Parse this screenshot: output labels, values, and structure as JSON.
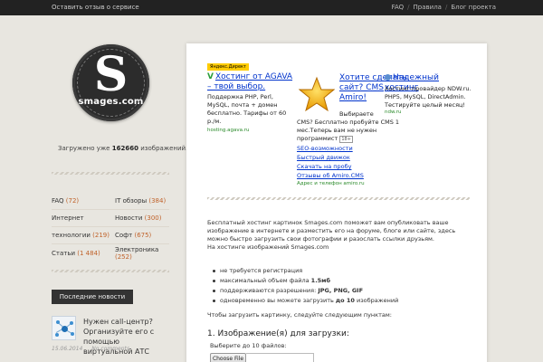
{
  "topbar": {
    "feedback": "Оставить отзыв о сервисе",
    "links": [
      "FAQ",
      "Правила",
      "Блог проекта"
    ]
  },
  "logo": {
    "letter": "S",
    "domain": "smages.com"
  },
  "stats": {
    "prefix": "Загружено уже",
    "count": "162660",
    "suffix": "изображений."
  },
  "categories": [
    [
      {
        "name": "FAQ",
        "count": "(72)"
      },
      {
        "name": "IT обзоры",
        "count": "(384)"
      }
    ],
    [
      {
        "name": "Интернет",
        "count": ""
      },
      {
        "name": "Новости",
        "count": "(300)"
      }
    ],
    [
      {
        "name": "технологии",
        "count": "(219)"
      },
      {
        "name": "Софт",
        "count": "(675)"
      }
    ],
    [
      {
        "name": "Статьи",
        "count": "(1 484)"
      },
      {
        "name": "Электроника",
        "count": "(252)"
      }
    ]
  ],
  "news": {
    "button": "Последние новости",
    "title": "Нужен call-центр? Организуйте его с помощью виртуальной АТС",
    "date": "15.06.2014",
    "comments": "No comments"
  },
  "ads": {
    "label": "Яндекс.Директ",
    "ad1": {
      "chevron": "V",
      "title": "Хостинг от AGAVA – твой выбор.",
      "text": "Поддержка PHP, Perl, MySQL, почта + домен бесплатно. Тарифы от 60 р./м.",
      "host": "hosting.agava.ru"
    },
    "ad2": {
      "title": "Хотите сделать сайт? CMS Amiro!",
      "text": "Выбираете",
      "text2": "CMS? Бесплатно пробуйте CMS 1 мес.Теперь вам не нужен программист",
      "age": "18+",
      "links": [
        "SEO-возможности",
        "Быстрый движок",
        "Скачать на пробу",
        "Отзывы об Amiro.CMS"
      ],
      "host": "Адрес и телефон  amiro.ru"
    },
    "ad3": {
      "title": "Надежный хостинг",
      "text": "Хостинг-провайдер NDW.ru. PHP5, MySQL, DirectAdmin. Тестируйте целый месяц!",
      "host": "ndw.ru"
    }
  },
  "content": {
    "description": "Бесплатный хостинг картинок Smages.com поможет вам опубликовать ваше изображение в интернете и разместить его на форуме, блоге или сайте, здесь можно быстро загрузить свои фотографии и разослать ссылки друзьям.",
    "subheading": "На хостинге изображений Smages.com",
    "features": [
      {
        "text": "не требуется регистрация",
        "bold": ""
      },
      {
        "text": "максимальный объем файла ",
        "bold": "1.5мб"
      },
      {
        "text": "поддерживаются разрешения: ",
        "bold": "JPG, PNG, GIF"
      },
      {
        "text": "одновременно вы можете загрузить ",
        "bold": "до 10",
        "after": " изображений"
      }
    ],
    "steps": "Чтобы загрузить картинку, следуйте следующим пунктам:",
    "upload_heading": "1. Изображение(я) для загрузки:",
    "upload_sub": "Выберите до 10 файлов:",
    "choose_button": "Choose File"
  },
  "colors": {
    "accent": "#c0622a",
    "link": "#0033cc",
    "topbar": "#222222"
  }
}
